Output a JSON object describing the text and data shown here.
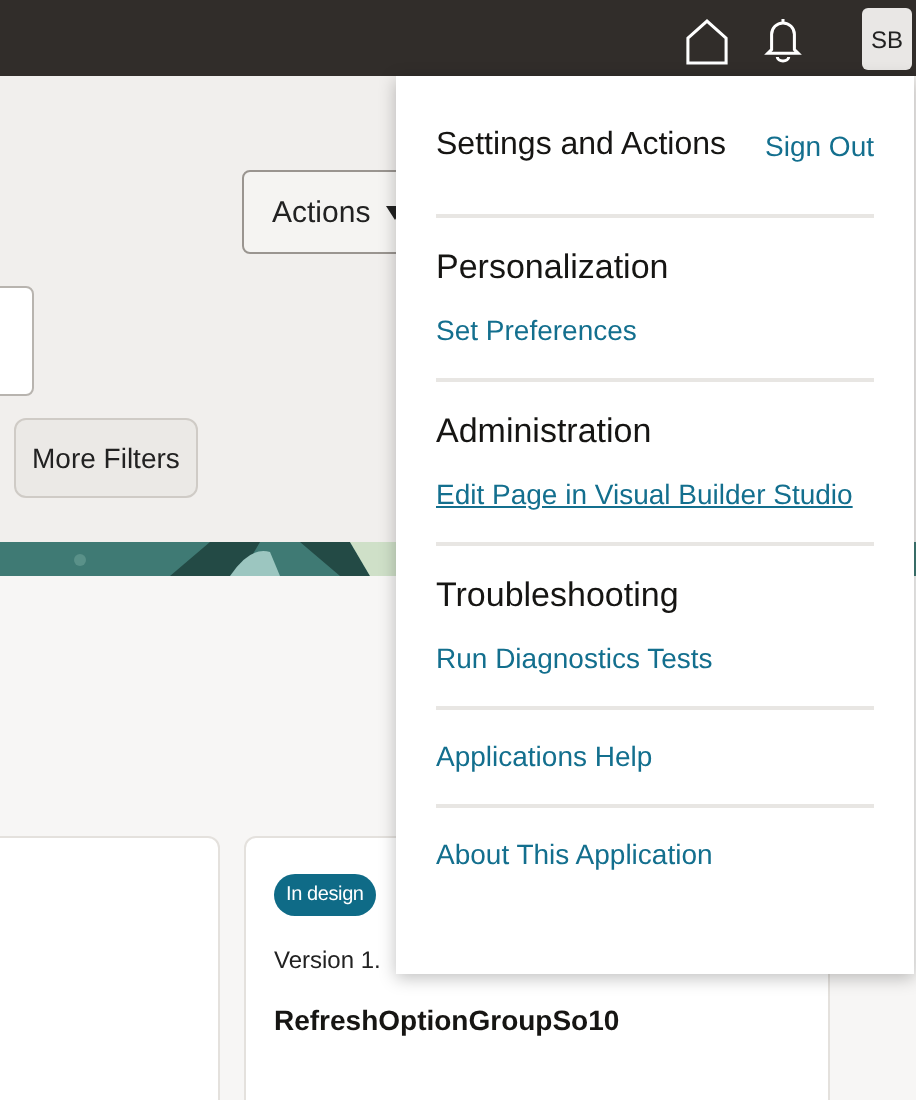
{
  "top_bar": {
    "avatar": "SB"
  },
  "toolbar": {
    "actions_button": "Actions"
  },
  "filters": {
    "more_filters_button": "More Filters"
  },
  "cards": [
    {
      "badge": "In design",
      "version": "Version 1.",
      "title": "RefreshOptionGroupSo10"
    }
  ],
  "menu": {
    "title": "Settings and Actions",
    "sign_out": "Sign Out",
    "sections": [
      {
        "heading": "Personalization",
        "links": [
          {
            "label": "Set Preferences",
            "focused": false
          }
        ]
      },
      {
        "heading": "Administration",
        "links": [
          {
            "label": "Edit Page in Visual Builder Studio",
            "focused": true
          }
        ]
      },
      {
        "heading": "Troubleshooting",
        "links": [
          {
            "label": "Run Diagnostics Tests",
            "focused": false
          }
        ]
      },
      {
        "links": [
          {
            "label": "Applications Help",
            "focused": false
          }
        ]
      },
      {
        "links": [
          {
            "label": "About This Application",
            "focused": false
          }
        ]
      }
    ]
  }
}
